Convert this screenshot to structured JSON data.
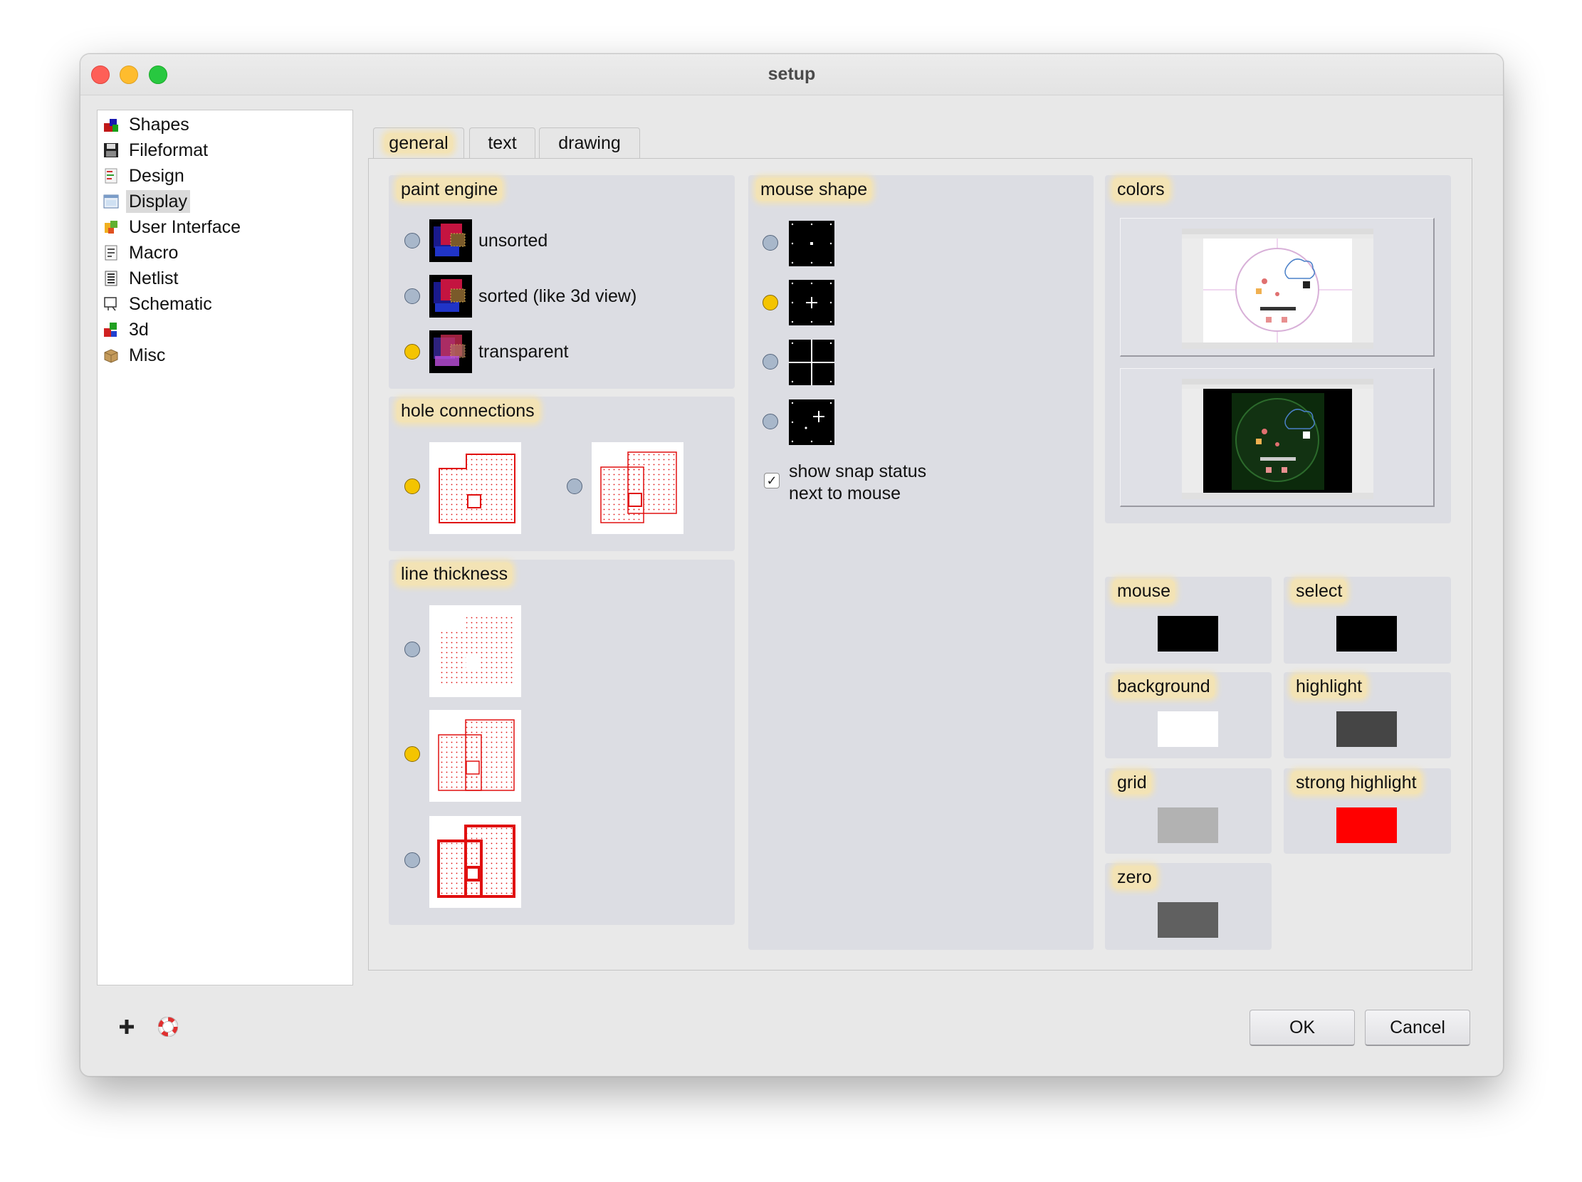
{
  "window": {
    "title": "setup"
  },
  "sidebar": {
    "items": [
      {
        "label": "Shapes",
        "icon": "shapes-icon",
        "selected": false
      },
      {
        "label": "Fileformat",
        "icon": "floppy-disk-icon",
        "selected": false
      },
      {
        "label": "Design",
        "icon": "design-icon",
        "selected": false
      },
      {
        "label": "Display",
        "icon": "display-icon",
        "selected": true
      },
      {
        "label": "User Interface",
        "icon": "user-interface-icon",
        "selected": false
      },
      {
        "label": "Macro",
        "icon": "macro-icon",
        "selected": false
      },
      {
        "label": "Netlist",
        "icon": "netlist-icon",
        "selected": false
      },
      {
        "label": "Schematic",
        "icon": "schematic-icon",
        "selected": false
      },
      {
        "label": "3d",
        "icon": "3d-icon",
        "selected": false
      },
      {
        "label": "Misc",
        "icon": "misc-box-icon",
        "selected": false
      }
    ]
  },
  "tabs": [
    {
      "label": "general",
      "active": true
    },
    {
      "label": "text",
      "active": false
    },
    {
      "label": "drawing",
      "active": false
    }
  ],
  "general": {
    "paint_engine": {
      "title": "paint engine",
      "options": [
        {
          "label": "unsorted",
          "icon": "paint-unsorted-icon",
          "selected": false
        },
        {
          "label": "sorted (like 3d view)",
          "icon": "paint-sorted-icon",
          "selected": false
        },
        {
          "label": "transparent",
          "icon": "paint-transparent-icon",
          "selected": true
        }
      ]
    },
    "hole_connections": {
      "title": "hole connections",
      "options": [
        {
          "icon": "hole-connected-icon",
          "selected": true
        },
        {
          "icon": "hole-separate-icon",
          "selected": false
        }
      ]
    },
    "line_thickness": {
      "title": "line thickness",
      "options": [
        {
          "icon": "line-none-icon",
          "selected": false
        },
        {
          "icon": "line-thin-icon",
          "selected": true
        },
        {
          "icon": "line-thick-icon",
          "selected": false
        }
      ]
    },
    "mouse_shape": {
      "title": "mouse shape",
      "options": [
        {
          "icon": "cursor-dot-icon",
          "selected": false
        },
        {
          "icon": "cursor-small-cross-icon",
          "selected": true
        },
        {
          "icon": "cursor-full-crosshair-icon",
          "selected": false
        },
        {
          "icon": "cursor-offset-cross-icon",
          "selected": false
        }
      ],
      "snap_status": {
        "lines": [
          "show snap status",
          "next to mouse"
        ],
        "checked": true
      }
    },
    "colors": {
      "title": "colors",
      "presets": [
        {
          "icon": "light-theme-preview-icon"
        },
        {
          "icon": "dark-theme-preview-icon"
        }
      ],
      "swatches": [
        {
          "label": "mouse",
          "color": "#000000"
        },
        {
          "label": "select",
          "color": "#000000"
        },
        {
          "label": "background",
          "color": "#ffffff"
        },
        {
          "label": "highlight",
          "color": "#454545"
        },
        {
          "label": "grid",
          "color": "#b2b2b2"
        },
        {
          "label": "strong highlight",
          "color": "#ff0000"
        },
        {
          "label": "zero",
          "color": "#606060"
        }
      ]
    }
  },
  "footer": {
    "add_icon": "plus-icon",
    "help_icon": "lifebuoy-icon",
    "ok_label": "OK",
    "cancel_label": "Cancel"
  }
}
